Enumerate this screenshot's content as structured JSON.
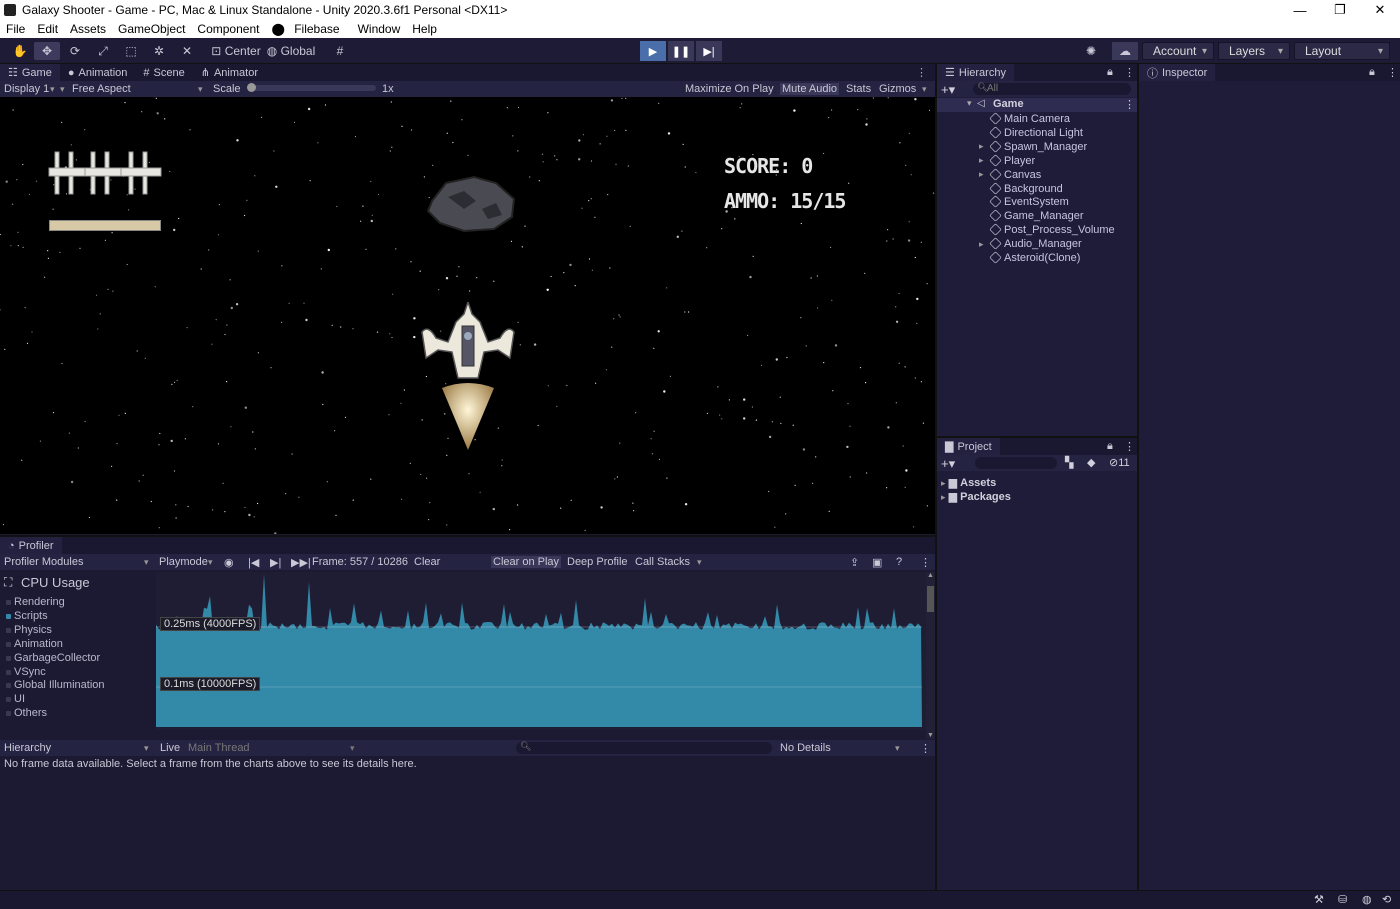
{
  "window": {
    "title": "Galaxy Shooter - Game - PC, Mac & Linux Standalone - Unity 2020.3.6f1 Personal <DX11>",
    "minimize": "—",
    "restore": "❐",
    "close": "✕"
  },
  "menu": [
    "File",
    "Edit",
    "Assets",
    "GameObject",
    "Component",
    "Filebase",
    "Window",
    "Help"
  ],
  "toolbar": {
    "center_label": "Center",
    "global_label": "Global",
    "account_label": "Account",
    "layers_label": "Layers",
    "layout_label": "Layout"
  },
  "game_tabs": [
    "Game",
    "Animation",
    "Scene",
    "Animator"
  ],
  "game_bar": {
    "display": "Display 1",
    "aspect": "Free Aspect",
    "scale_label": "Scale",
    "scale_value": "1x",
    "maximize": "Maximize On Play",
    "mute": "Mute Audio",
    "stats": "Stats",
    "gizmos": "Gizmos"
  },
  "hud": {
    "score": "SCORE: 0",
    "ammo": "AMMO: 15/15",
    "lives": 3,
    "thruster_fill": 1.0
  },
  "hierarchy": {
    "tab": "Hierarchy",
    "search_placeholder": "All",
    "scene": "Game",
    "items": [
      {
        "label": "Main Camera",
        "expandable": false
      },
      {
        "label": "Directional Light",
        "expandable": false
      },
      {
        "label": "Spawn_Manager",
        "expandable": true
      },
      {
        "label": "Player",
        "expandable": true
      },
      {
        "label": "Canvas",
        "expandable": true
      },
      {
        "label": "Background",
        "expandable": false
      },
      {
        "label": "EventSystem",
        "expandable": false
      },
      {
        "label": "Game_Manager",
        "expandable": false
      },
      {
        "label": "Post_Process_Volume",
        "expandable": false
      },
      {
        "label": "Audio_Manager",
        "expandable": true
      },
      {
        "label": "Asteroid(Clone)",
        "expandable": false
      }
    ]
  },
  "inspector": {
    "tab": "Inspector"
  },
  "project": {
    "tab": "Project",
    "hidden_count": "11",
    "folders": [
      "Assets",
      "Packages"
    ]
  },
  "profiler": {
    "tab": "Profiler",
    "modules_label": "Profiler Modules",
    "mode": "Playmode",
    "frame": "Frame: 557 / 10286",
    "clear": "Clear",
    "clear_on_play": "Clear on Play",
    "deep_profile": "Deep Profile",
    "call_stacks": "Call Stacks",
    "cpu_title": "CPU Usage",
    "categories": [
      "Rendering",
      "Scripts",
      "Physics",
      "Animation",
      "GarbageCollector",
      "VSync",
      "Global Illumination",
      "UI",
      "Others"
    ],
    "marker_high": "0.25ms (4000FPS)",
    "marker_low": "0.1ms (10000FPS)",
    "bottom_view": "Hierarchy",
    "live": "Live",
    "thread": "Main Thread",
    "details": "No Details",
    "empty_message": "No frame data available. Select a frame from the charts above to see its details here."
  },
  "colors": {
    "chart_fill": "#3389a8",
    "panel_bg": "#1c1a33",
    "play_active": "#4a6ea9"
  }
}
